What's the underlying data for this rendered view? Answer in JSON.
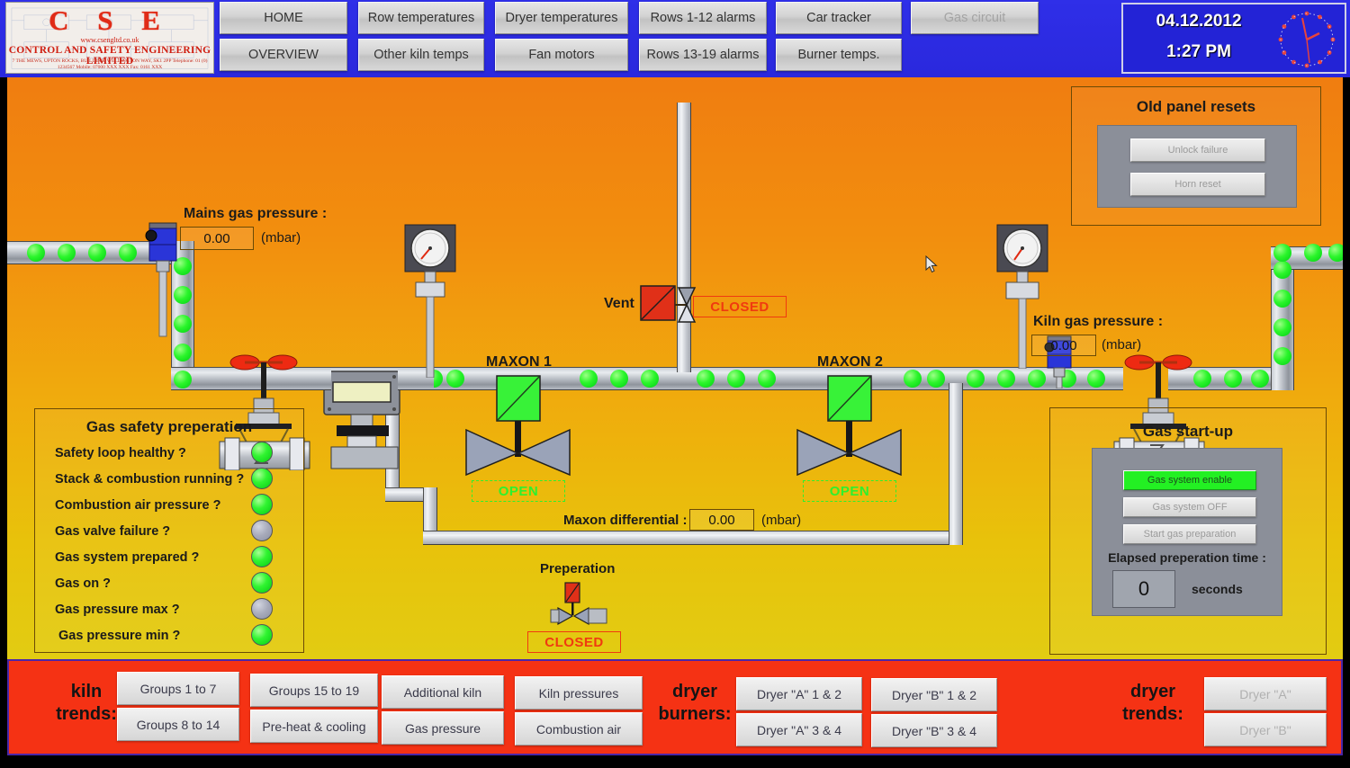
{
  "header": {
    "logo": {
      "brand": "C S E",
      "url": "www.csengltd.co.uk",
      "subtitle": "CONTROL AND SAFETY ENGINEERING LIMITED",
      "address": "7 THE MEWS, UPTON ROCKS, BUILDING, WELLINGTON WAY, SK1 2PP    Telephone: 01 (0) 1234567    Mobile: 07000 XXX XXX  Fax: 0161 XXX"
    },
    "nav": [
      {
        "label": "HOME",
        "state": "enabled"
      },
      {
        "label": "Row temperatures",
        "state": "enabled"
      },
      {
        "label": "Dryer temperatures",
        "state": "enabled"
      },
      {
        "label": "Rows 1-12 alarms",
        "state": "enabled"
      },
      {
        "label": "Car tracker",
        "state": "enabled"
      },
      {
        "label": "Gas circuit",
        "state": "disabled"
      },
      {
        "label": "OVERVIEW",
        "state": "enabled"
      },
      {
        "label": "Other kiln temps",
        "state": "enabled"
      },
      {
        "label": "Fan motors",
        "state": "enabled"
      },
      {
        "label": "Rows 13-19 alarms",
        "state": "enabled"
      },
      {
        "label": "Burner temps.",
        "state": "enabled"
      }
    ],
    "clock": {
      "date": "04.12.2012",
      "time": "1:27 PM"
    }
  },
  "diagram": {
    "mains_pressure": {
      "label": "Mains gas pressure :",
      "value": "0.00",
      "units": "(mbar)"
    },
    "kiln_pressure": {
      "label": "Kiln gas pressure :",
      "value": "0.00",
      "units": "(mbar)"
    },
    "maxon_differential": {
      "label": "Maxon differential :",
      "value": "0.00",
      "units": "(mbar)"
    },
    "vent": {
      "label": "Vent",
      "state": "CLOSED",
      "state_color": "#f03a10"
    },
    "maxon1": {
      "label": "MAXON 1",
      "state": "OPEN",
      "state_color": "#2ef02e"
    },
    "maxon2": {
      "label": "MAXON 2",
      "state": "OPEN",
      "state_color": "#2ef02e"
    },
    "preperation": {
      "label": "Preperation",
      "state": "CLOSED",
      "state_color": "#f03a10"
    }
  },
  "safety_panel": {
    "title": "Gas safety preperation",
    "items": [
      {
        "label": "Safety loop healthy ?",
        "state": "on"
      },
      {
        "label": "Stack & combustion running ?",
        "state": "on"
      },
      {
        "label": "Combustion air pressure ?",
        "state": "on"
      },
      {
        "label": "Gas valve failure ?",
        "state": "off"
      },
      {
        "label": "Gas system prepared ?",
        "state": "on"
      },
      {
        "label": "Gas on ?",
        "state": "on"
      },
      {
        "label": "Gas pressure max ?",
        "state": "off"
      },
      {
        "label": "Gas pressure min ?",
        "state": "on"
      }
    ]
  },
  "old_panel_resets": {
    "title": "Old panel resets",
    "buttons": [
      {
        "label": "Unlock failure"
      },
      {
        "label": "Horn reset"
      }
    ]
  },
  "gas_startup": {
    "title": "Gas start-up",
    "buttons": [
      {
        "label": "Gas system enable",
        "state": "active"
      },
      {
        "label": "Gas system OFF",
        "state": "inactive"
      },
      {
        "label": "Start gas preparation",
        "state": "inactive"
      }
    ],
    "elapsed_label": "Elapsed preperation time :",
    "elapsed_value": "0",
    "elapsed_units": "seconds"
  },
  "bottom_bar": {
    "groups": [
      {
        "label": "kiln\ntrends:",
        "label_line1": "kiln",
        "label_line2": "trends:",
        "buttons": [
          "Groups 1 to 7",
          "Groups 15 to 19",
          "Groups 8 to 14",
          "Pre-heat & cooling"
        ]
      },
      {
        "buttons": [
          "Additional kiln",
          "Kiln pressures",
          "Gas pressure",
          "Combustion air"
        ]
      },
      {
        "label_line1": "dryer",
        "label_line2": "burners:",
        "buttons": [
          "Dryer \"A\" 1 & 2",
          "Dryer \"B\" 1 & 2",
          "Dryer \"A\" 3 & 4",
          "Dryer \"B\" 3 & 4"
        ]
      },
      {
        "label_line1": "dryer",
        "label_line2": "trends:",
        "buttons": [
          "Dryer \"A\"",
          "Dryer \"B\""
        ]
      }
    ]
  },
  "colors": {
    "nav_bar": "#2a2ae0",
    "bottom_bar": "#f53214",
    "lamp_on": "#31f431",
    "lamp_off": "#a8abbb",
    "open_green": "#2ef02e",
    "closed_red": "#f03a10"
  }
}
